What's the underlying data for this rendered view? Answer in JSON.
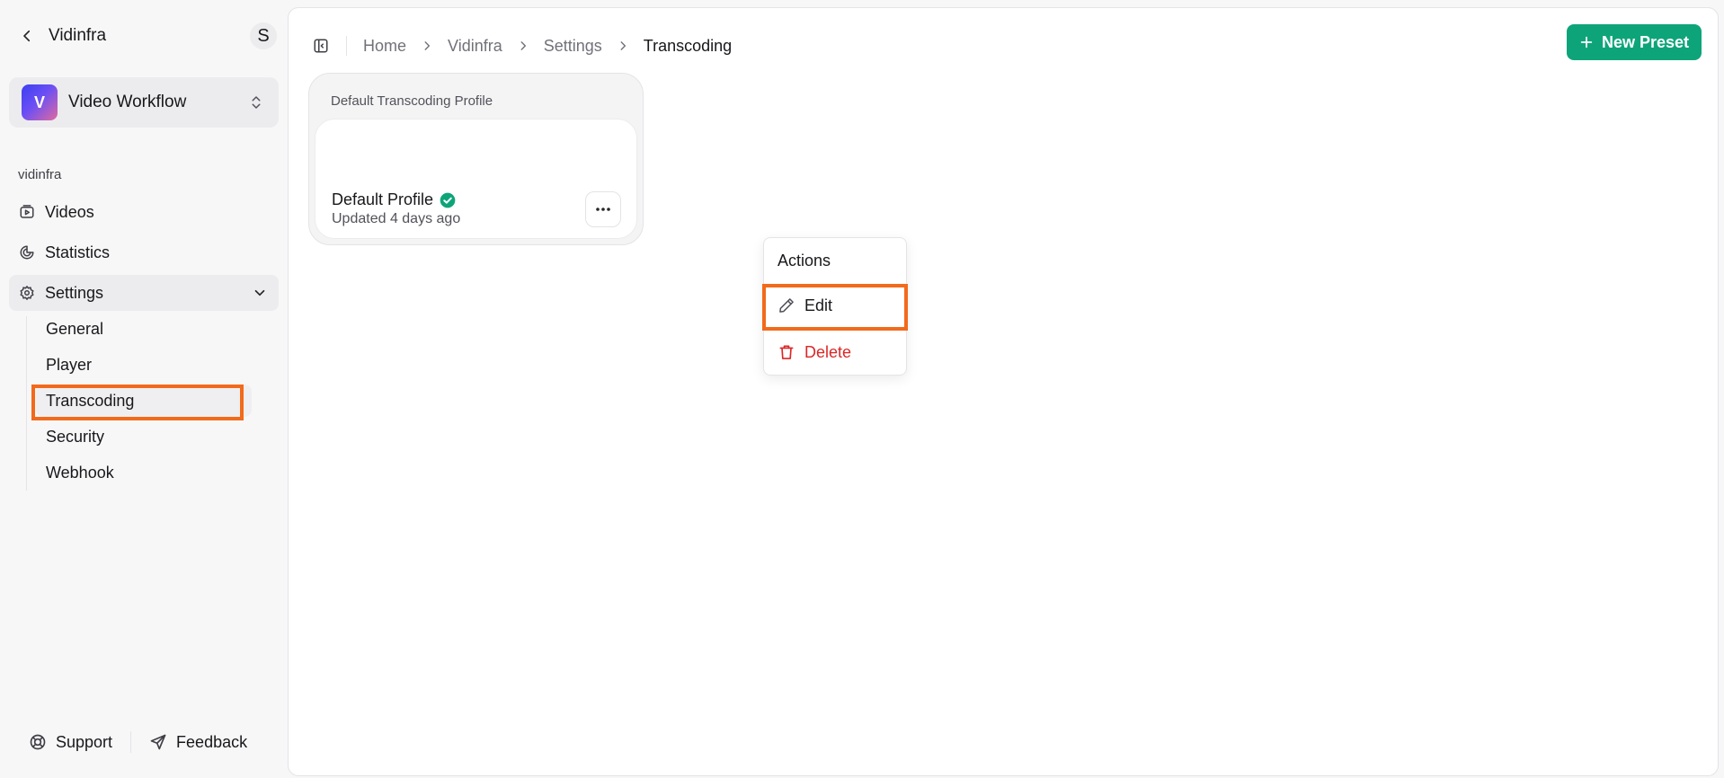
{
  "sidebar": {
    "org_name": "Vidinfra",
    "user_initial": "S",
    "workspace": {
      "logo_letter": "V",
      "name": "Video Workflow"
    },
    "section_label": "vidinfra",
    "nav": [
      {
        "label": "Videos",
        "icon": "video-icon"
      },
      {
        "label": "Statistics",
        "icon": "chart-pie-icon"
      },
      {
        "label": "Settings",
        "icon": "gear-icon",
        "expanded": true
      }
    ],
    "settings_sub": [
      "General",
      "Player",
      "Transcoding",
      "Security",
      "Webhook"
    ],
    "active_sub": "Transcoding",
    "footer": {
      "support": "Support",
      "feedback": "Feedback"
    }
  },
  "header": {
    "breadcrumb": [
      "Home",
      "Vidinfra",
      "Settings",
      "Transcoding"
    ],
    "new_preset_label": "New Preset"
  },
  "content": {
    "group_title": "Default Transcoding Profile",
    "profile": {
      "name": "Default Profile",
      "verified": true,
      "updated": "Updated 4 days ago"
    },
    "actions_menu": {
      "title": "Actions",
      "edit_label": "Edit",
      "delete_label": "Delete"
    }
  },
  "colors": {
    "accent": "#0ea47a",
    "highlight": "#f26a1b",
    "danger": "#dc2626"
  }
}
